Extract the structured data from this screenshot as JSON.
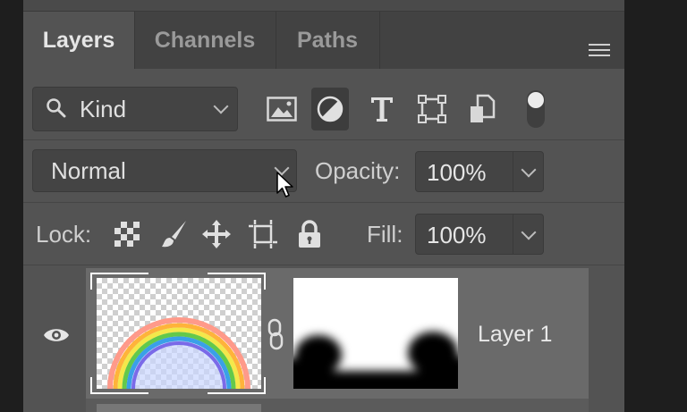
{
  "tabs": [
    {
      "label": "Layers",
      "active": true
    },
    {
      "label": "Channels",
      "active": false
    },
    {
      "label": "Paths",
      "active": false
    }
  ],
  "filter": {
    "kind_label": "Kind",
    "icons": [
      "image-filter-icon",
      "adjustment-filter-icon",
      "type-filter-icon",
      "shape-filter-icon",
      "smart-object-filter-icon",
      "filter-toggle-icon"
    ],
    "active_icon": "adjustment-filter-icon"
  },
  "blend": {
    "mode": "Normal",
    "opacity_label": "Opacity:",
    "opacity_value": "100%"
  },
  "lock": {
    "label": "Lock:",
    "icons": [
      "lock-transparent-pixels-icon",
      "lock-image-pixels-icon",
      "lock-position-icon",
      "lock-artboard-icon",
      "lock-all-icon"
    ],
    "fill_label": "Fill:",
    "fill_value": "100%"
  },
  "layers": [
    {
      "name": "Layer 1",
      "visible": true,
      "selected": true
    }
  ],
  "colors": {
    "panel": "#535353",
    "tabbar": "#424242",
    "selected_layer": "#6a6a6a"
  }
}
